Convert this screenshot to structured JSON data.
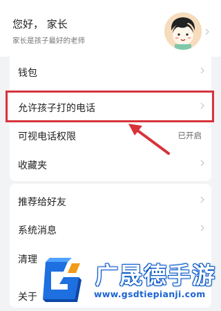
{
  "header": {
    "greeting": "您好， 家长",
    "subtitle": "家长是孩子最好的老师"
  },
  "menu_group1": [
    {
      "label": "钱包",
      "status": ""
    },
    {
      "label": "允许孩子打的电话",
      "status": ""
    },
    {
      "label": "可视电话权限",
      "status": "已开启"
    },
    {
      "label": "收藏夹",
      "status": ""
    }
  ],
  "menu_group2": [
    {
      "label": "推荐给好友"
    },
    {
      "label": "系统消息"
    },
    {
      "label": "清理"
    },
    {
      "label": "关于"
    }
  ],
  "watermark": {
    "title": "广晟德手游",
    "url": "www.gsdtiepianji.com"
  },
  "colors": {
    "highlight": "#d8323a",
    "background": "#f2f3f5",
    "watermark_blue": "#1b63d4"
  }
}
